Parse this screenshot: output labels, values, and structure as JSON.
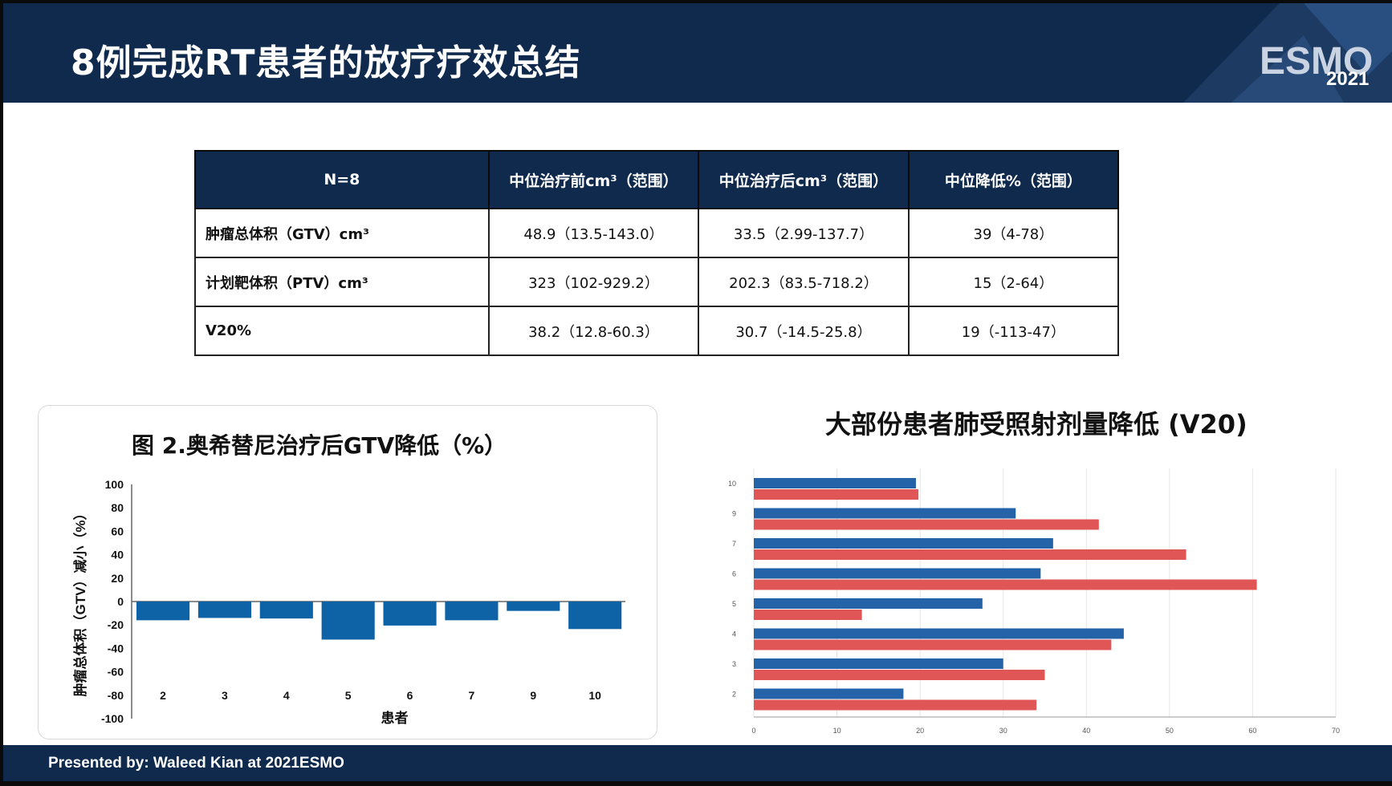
{
  "header": {
    "title": "8例完成RT患者的放疗疗效总结",
    "logo_text": "ESMO",
    "logo_year": "2021"
  },
  "table": {
    "headers": [
      "N=8",
      "中位治疗前cm³（范围）",
      "中位治疗后cm³（范围）",
      "中位降低%（范围）"
    ],
    "rows": [
      {
        "label": "肿瘤总体积（GTV）cm³",
        "before": "48.9（13.5-143.0）",
        "after": "33.5（2.99-137.7）",
        "reduction": "39（4-78）"
      },
      {
        "label": "计划靶体积（PTV）cm³",
        "before": "323（102-929.2）",
        "after": "202.3（83.5-718.2）",
        "reduction": "15（2-64）"
      },
      {
        "label": "V20%",
        "before": "38.2（12.8-60.3）",
        "after": "30.7（-14.5-25.8）",
        "reduction": "19（-113-47）"
      }
    ]
  },
  "chart_data": [
    {
      "type": "bar",
      "title": "图 2.奥希替尼治疗后GTV降低（%）",
      "xlabel": "患者",
      "ylabel": "肿瘤总体积（GTV）减小（%）",
      "categories": [
        "2",
        "3",
        "4",
        "5",
        "6",
        "7",
        "9",
        "10"
      ],
      "values": [
        -16,
        -14,
        -14.5,
        -32.5,
        -20.5,
        -16,
        -8,
        -23.5
      ],
      "ylim": [
        -100,
        100
      ],
      "yticks": [
        100,
        80,
        60,
        40,
        20,
        0,
        -20,
        -40,
        -60,
        -80,
        -100
      ],
      "color": "#0d63a5",
      "grid": false
    },
    {
      "type": "bar",
      "orientation": "horizontal",
      "title": "大部份患者肺受照射剂量降低 (V20)",
      "categories": [
        "10",
        "9",
        "7",
        "6",
        "5",
        "4",
        "3",
        "2"
      ],
      "yticks": [
        "10",
        "9",
        "7",
        "6",
        "5",
        "4",
        "3",
        "2"
      ],
      "series": [
        {
          "color": "#2563a8",
          "values": [
            19.5,
            31.5,
            36,
            34.5,
            27.5,
            44.5,
            30,
            18
          ]
        },
        {
          "color": "#e05555",
          "values": [
            19.8,
            41.5,
            52,
            60.5,
            13,
            43,
            35,
            34
          ]
        }
      ],
      "xlim": [
        0,
        70
      ],
      "xticks": [
        0,
        10,
        20,
        30,
        40,
        50,
        60,
        70
      ],
      "grid": true
    }
  ],
  "footer": {
    "text": "Presented by:  Waleed Kian at 2021ESMO"
  },
  "colors": {
    "header_bg": "#0f2a4d",
    "bar_blue": "#0d63a5",
    "series_blue": "#2563a8",
    "series_red": "#e05555"
  }
}
